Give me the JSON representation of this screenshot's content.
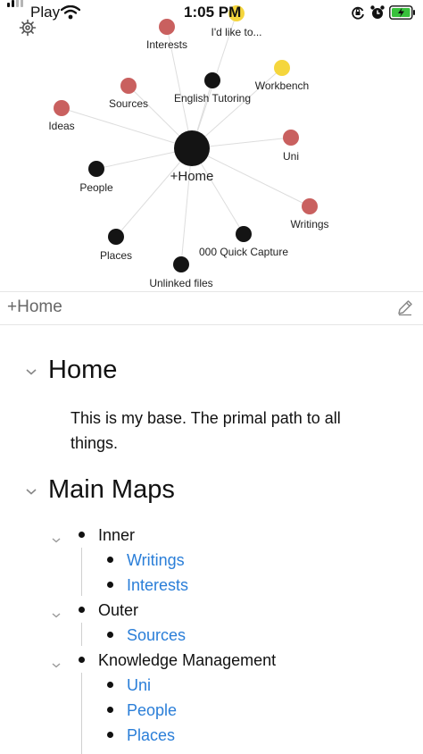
{
  "status_bar": {
    "carrier": "Play",
    "time": "1:05 PM"
  },
  "graph": {
    "center": "+Home",
    "nodes": [
      {
        "label": "I'd like to...",
        "color": "#f5d63d"
      },
      {
        "label": "Interests",
        "color": "#c9605f"
      },
      {
        "label": "Workbench",
        "color": "#f5d63d"
      },
      {
        "label": "English Tutoring",
        "color": "#141414"
      },
      {
        "label": "Sources",
        "color": "#c9605f"
      },
      {
        "label": "Ideas",
        "color": "#c9605f"
      },
      {
        "label": "Uni",
        "color": "#c9605f"
      },
      {
        "label": "People",
        "color": "#141414"
      },
      {
        "label": "Writings",
        "color": "#c9605f"
      },
      {
        "label": "000 Quick Capture",
        "color": "#141414"
      },
      {
        "label": "Places",
        "color": "#141414"
      },
      {
        "label": "Unlinked files",
        "color": "#141414"
      }
    ]
  },
  "note": {
    "title": "+Home",
    "sections": [
      {
        "heading": "Home",
        "body": "This is my base. The primal path to all things."
      },
      {
        "heading": "Main Maps"
      }
    ],
    "maps": [
      {
        "label": "Inner",
        "children": [
          "Writings",
          "Interests"
        ]
      },
      {
        "label": "Outer",
        "children": [
          "Sources"
        ]
      },
      {
        "label": "Knowledge Management",
        "children": [
          "Uni",
          "People",
          "Places"
        ]
      }
    ]
  },
  "colors": {
    "link": "#2a7ed8",
    "tag_red": "#c9605f",
    "tag_yellow": "#f5d63d",
    "node_black": "#141414"
  }
}
